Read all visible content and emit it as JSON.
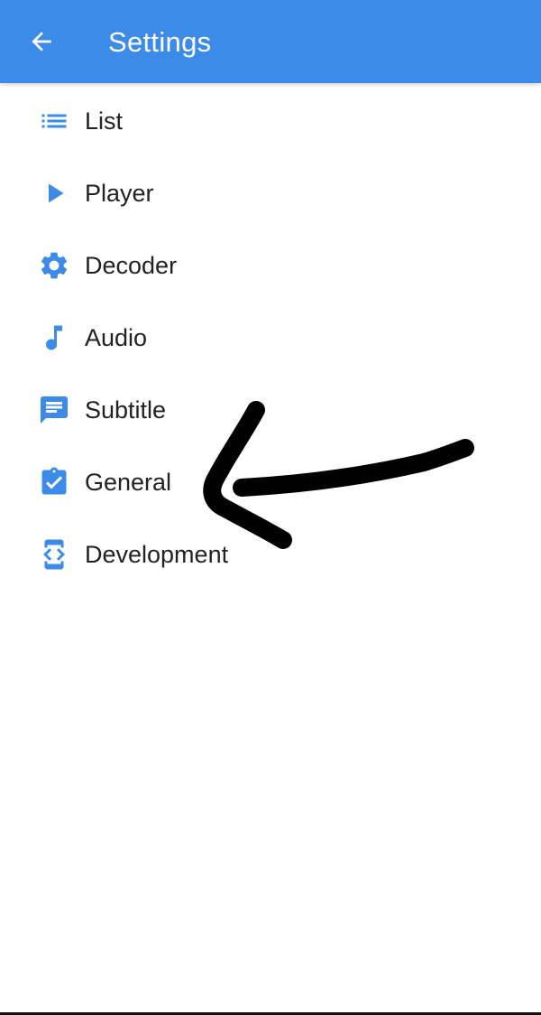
{
  "app_bar": {
    "title": "Settings",
    "back_icon": "arrow-left-icon",
    "background_color": "#3d8be8"
  },
  "menu": {
    "icon_color": "#3d8be8",
    "items": [
      {
        "label": "List",
        "icon": "list-icon"
      },
      {
        "label": "Player",
        "icon": "play-icon"
      },
      {
        "label": "Decoder",
        "icon": "gear-icon"
      },
      {
        "label": "Audio",
        "icon": "music-note-icon"
      },
      {
        "label": "Subtitle",
        "icon": "chat-icon"
      },
      {
        "label": "General",
        "icon": "clipboard-check-icon"
      },
      {
        "label": "Development",
        "icon": "developer-mode-icon"
      }
    ]
  },
  "annotation": {
    "type": "hand-drawn-arrow",
    "color": "#000000",
    "points_to": "General"
  }
}
